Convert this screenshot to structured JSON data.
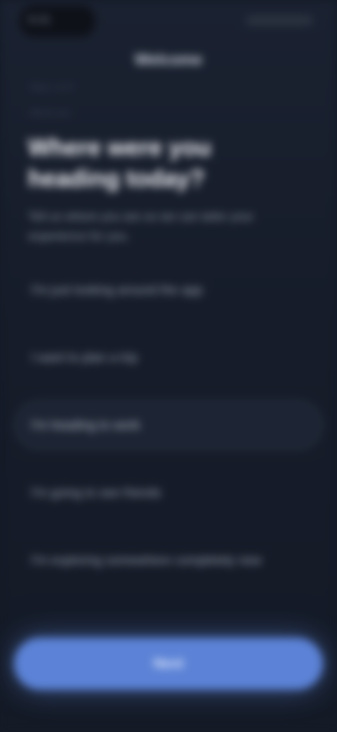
{
  "status_bar": {
    "time": "9:41"
  },
  "header": {
    "title": "Welcome"
  },
  "step": {
    "label": "Step 1 of 3",
    "sub": "About you"
  },
  "question": "Where were you heading today?",
  "description": "Tell us where you are so we can tailor your experience for you.",
  "options": [
    {
      "label": "I'm just looking around the app"
    },
    {
      "label": "I want to plan a trip"
    },
    {
      "label": "I'm heading to work"
    },
    {
      "label": "I'm going to see friends"
    },
    {
      "label": "I'm exploring somewhere completely new"
    }
  ],
  "selected_index": 2,
  "continue_label": "Next",
  "colors": {
    "accent": "#5b82d6",
    "background": "#141a26"
  }
}
